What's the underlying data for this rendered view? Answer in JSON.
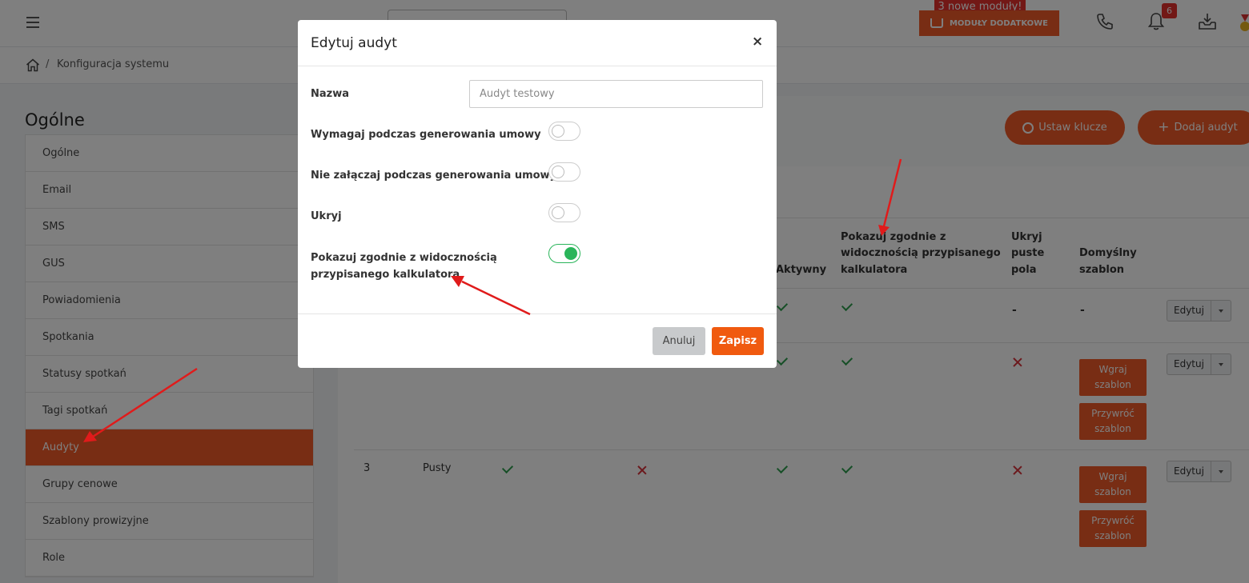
{
  "topbar": {
    "new_modules_badge": "3 nowe moduły!",
    "modules_button": "MODUŁY DODATKOWE",
    "notifications_count": "6"
  },
  "breadcrumb": {
    "separator": "/",
    "current": "Konfiguracja systemu"
  },
  "sidebar": {
    "title": "Ogólne",
    "items": [
      {
        "label": "Ogólne"
      },
      {
        "label": "Email"
      },
      {
        "label": "SMS"
      },
      {
        "label": "GUS"
      },
      {
        "label": "Powiadomienia"
      },
      {
        "label": "Spotkania"
      },
      {
        "label": "Statusy spotkań"
      },
      {
        "label": "Tagi spotkań"
      },
      {
        "label": "Audyty",
        "active": true
      },
      {
        "label": "Grupy cenowe"
      },
      {
        "label": "Szablony prowizyjne"
      },
      {
        "label": "Role"
      }
    ]
  },
  "main": {
    "set_keys_button": "Ustaw klucze",
    "add_audit_button": "Dodaj audyt",
    "table": {
      "headers": {
        "active": "Aktywny",
        "show_calc_1": "Pokazuj zgodnie z",
        "show_calc_2": "widocznością przypisanego",
        "show_calc_3": "kalkulatora",
        "hide_empty_1": "Ukryj",
        "hide_empty_2": "puste",
        "hide_empty_3": "pola",
        "default_tpl_1": "Domyślny",
        "default_tpl_2": "szablon"
      },
      "row3_number": "3",
      "row3_name": "Pusty",
      "dash": "-",
      "edit_label": "Edytuj",
      "upload_line1": "Wgraj",
      "upload_line2": "szablon",
      "restore_line1": "Przywróć",
      "restore_line2": "szablon"
    }
  },
  "modal": {
    "title": "Edytuj audyt",
    "close": "×",
    "name_label": "Nazwa",
    "name_placeholder": "Audyt testowy",
    "name_value": "",
    "toggle1_label": "Wymagaj podczas generowania umowy",
    "toggle1_on": false,
    "toggle2_label": "Nie załączaj podczas generowania umowy",
    "toggle2_on": false,
    "toggle3_label": "Ukryj",
    "toggle3_on": false,
    "toggle4_label_line1": "Pokazuj zgodnie z widocznością",
    "toggle4_label_line2": "przypisanego kalkulatora",
    "toggle4_on": true,
    "cancel_button": "Anuluj",
    "save_button": "Zapisz"
  },
  "colors": {
    "accent": "#f05a28",
    "toggle_on": "#2ab55a",
    "check": "#2e9e4f",
    "cross": "#d8333a",
    "arrow": "#e01b1b"
  }
}
